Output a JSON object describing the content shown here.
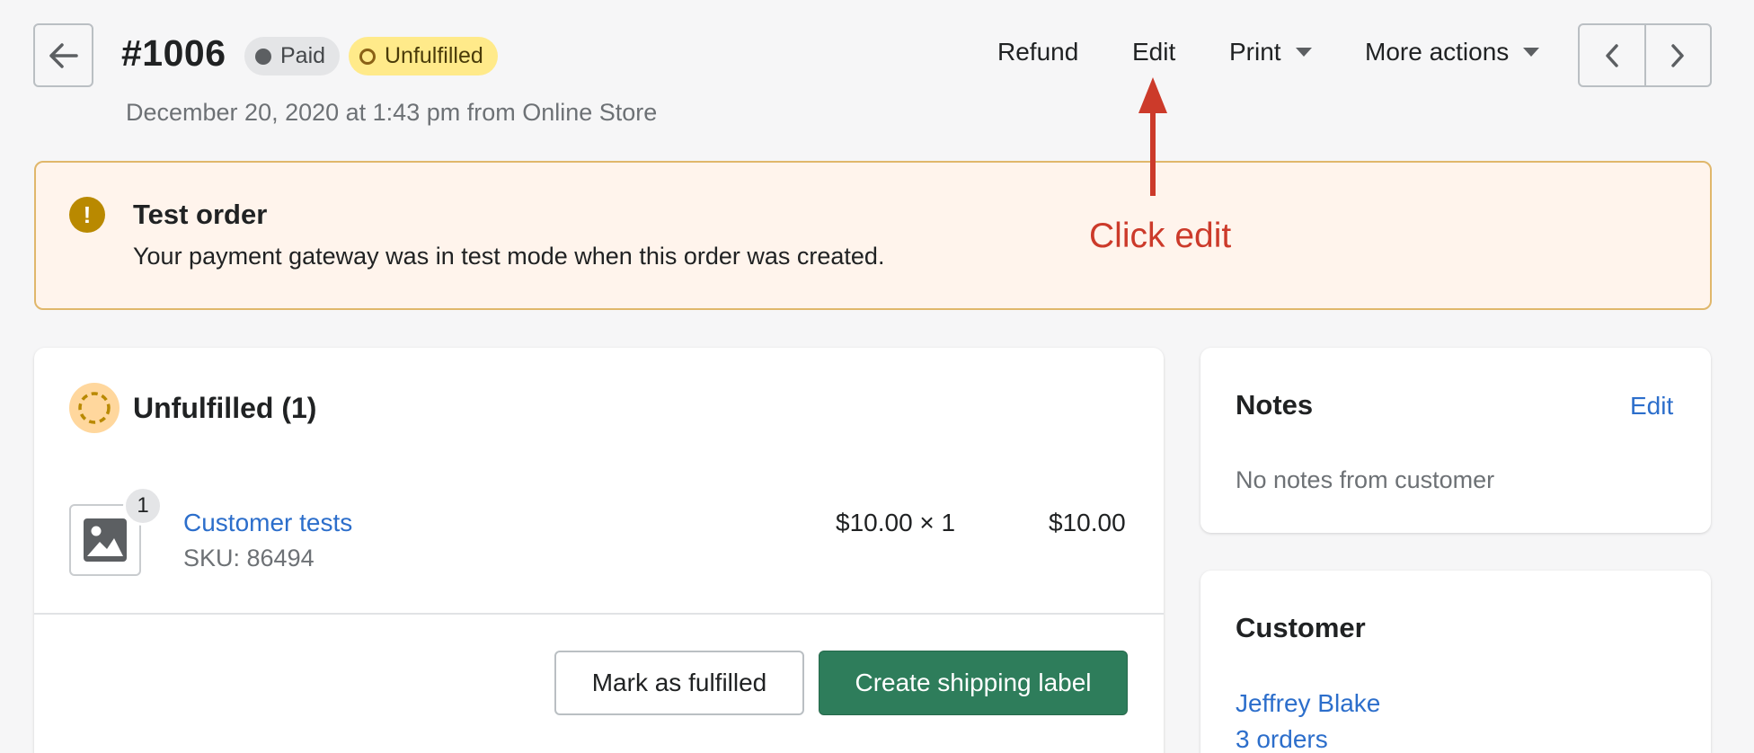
{
  "header": {
    "order_number": "#1006",
    "paid_badge": "Paid",
    "fulfillment_badge": "Unfulfilled",
    "subtitle": "December 20, 2020 at 1:43 pm from Online Store",
    "actions": {
      "refund": "Refund",
      "edit": "Edit",
      "print": "Print",
      "more_actions": "More actions"
    }
  },
  "annotation": {
    "text": "Click edit",
    "color": "#cc3a2a"
  },
  "banner": {
    "icon": "exclamation-icon",
    "title": "Test order",
    "text": "Your payment gateway was in test mode when this order was created."
  },
  "fulfillment": {
    "title": "Unfulfilled (1)",
    "item": {
      "quantity_badge": "1",
      "name": "Customer tests",
      "sku": "SKU: 86494",
      "unit_price": "$10.00 × 1",
      "total": "$10.00"
    },
    "buttons": {
      "mark_fulfilled": "Mark as fulfilled",
      "create_label": "Create shipping label"
    }
  },
  "notes": {
    "title": "Notes",
    "edit": "Edit",
    "text": "No notes from customer"
  },
  "customer": {
    "title": "Customer",
    "name": "Jeffrey Blake",
    "orders": "3 orders"
  },
  "colors": {
    "primary_button": "#2e7d5b",
    "link": "#2c6ecb",
    "banner_bg": "#fff4ec",
    "unfulfilled_badge": "#ffea8a"
  }
}
